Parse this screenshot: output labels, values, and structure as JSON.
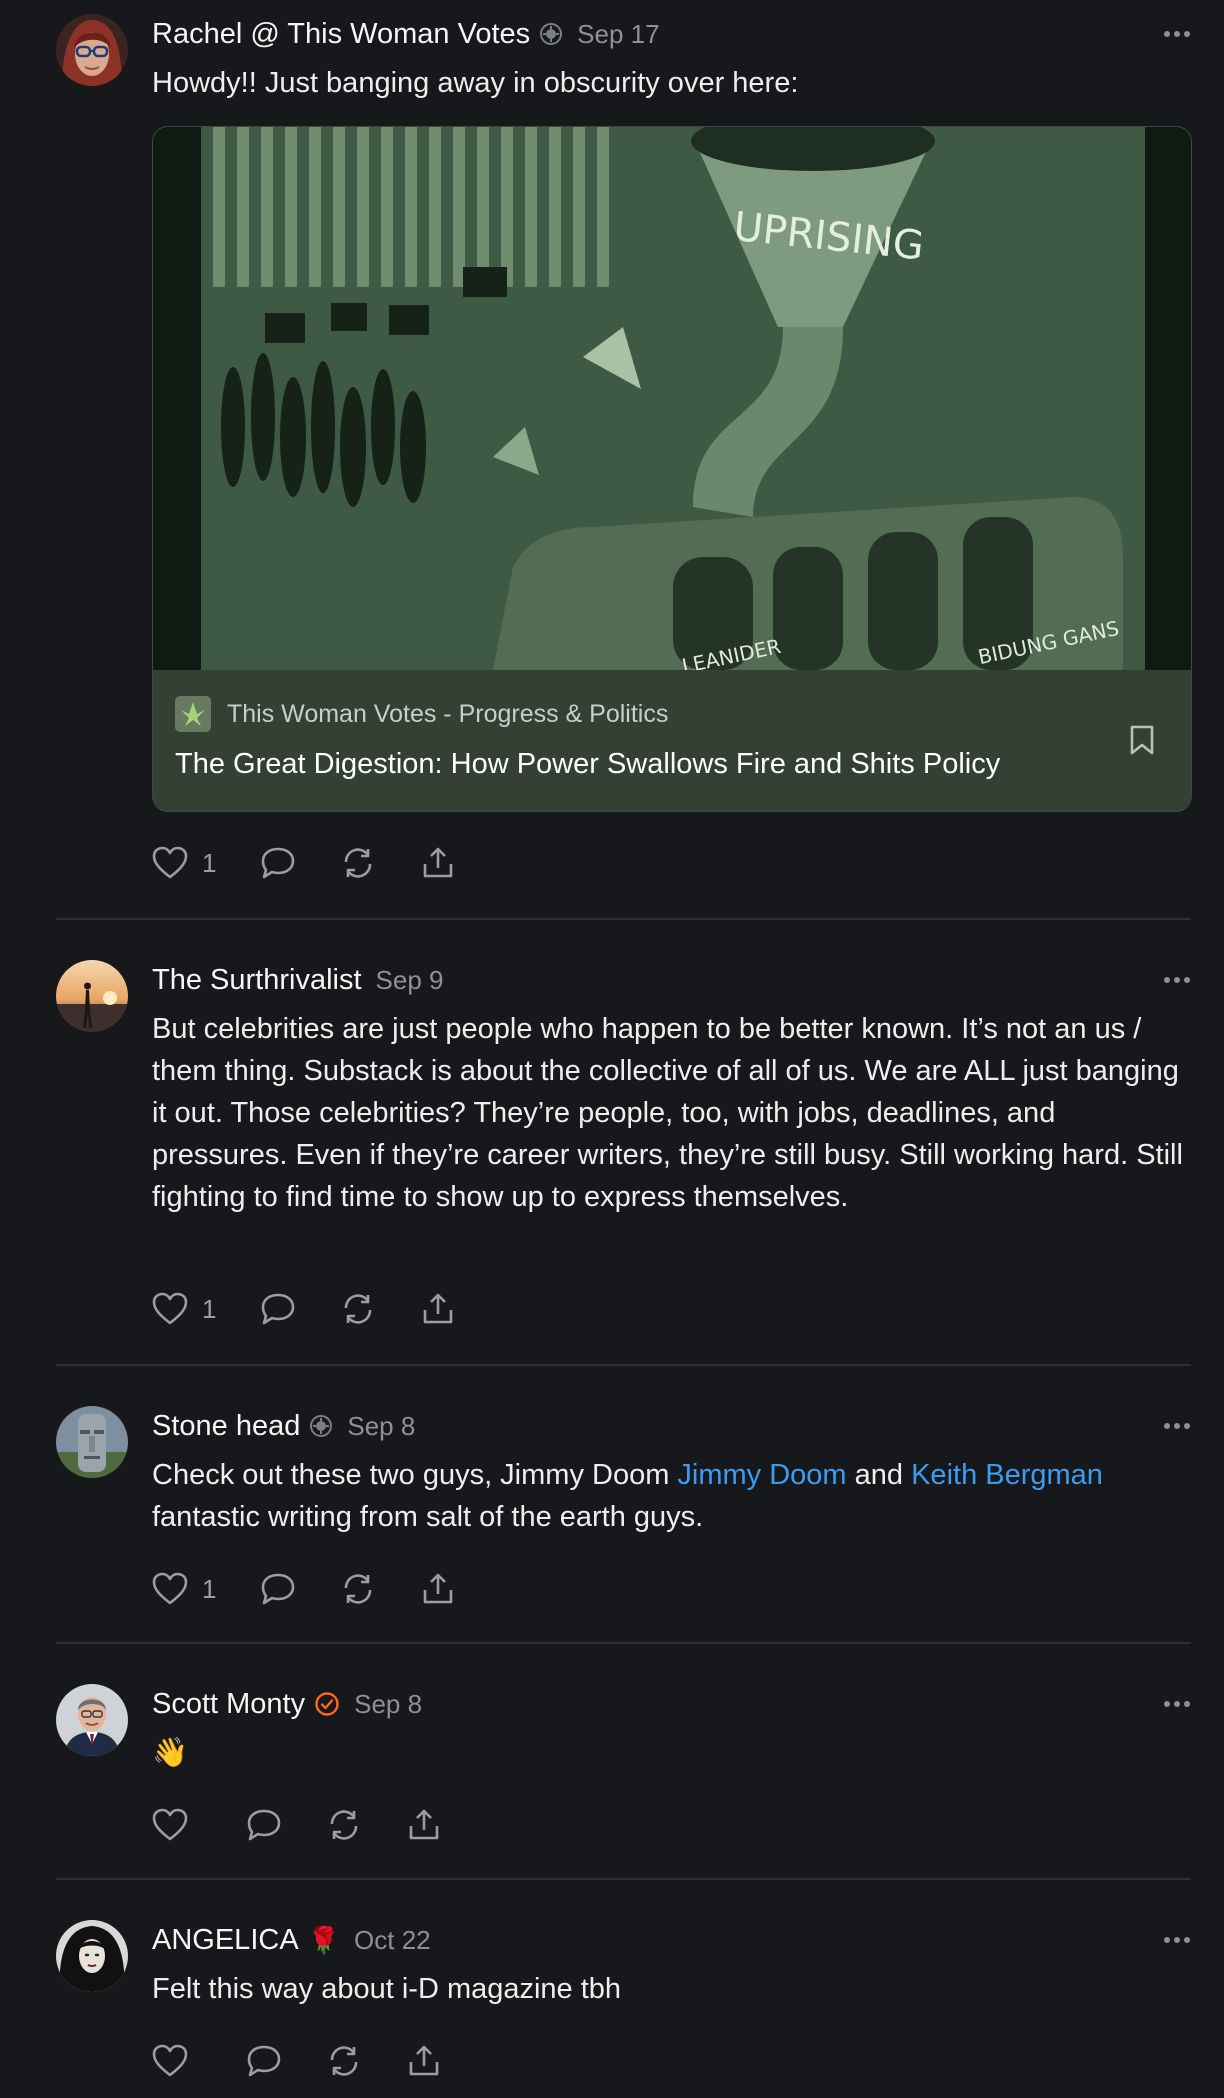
{
  "posts": [
    {
      "author": "Rachel @ This Woman Votes",
      "date": "Sep 17",
      "text": "Howdy!! Just banging away in obscurity over here:",
      "card": {
        "publication": "This Woman Votes - Progress & Politics",
        "title": "The Great Digestion: How Power Swallows Fire and Shits Policy",
        "image_text": {
          "funnel": "UPRISING",
          "slot_1": "LEANIDER",
          "slot_4": "BIDUNG GANS"
        }
      },
      "likes": "1"
    },
    {
      "author": "The Surthrivalist",
      "date": "Sep 9",
      "text": "But celebrities are just people who happen to be better known. It’s not an us / them thing. Substack is about the collective of all of us. We are ALL just banging it out. Those celebrities? They’re people, too, with jobs, deadlines, and pressures. Even if they’re career writers, they’re still busy. Still working hard. Still fighting to find time to show up to express themselves.",
      "likes": "1"
    },
    {
      "author": "Stone head",
      "date": "Sep 8",
      "text_before": "Check out these two guys, Jimmy Doom ",
      "mention_1": "Jimmy Doom",
      "text_middle": " and ",
      "mention_2": "Keith Bergman",
      "text_after": "fantastic writing from salt of the earth guys.",
      "likes": "1"
    },
    {
      "author": "Scott Monty",
      "date": "Sep 8",
      "text": "👋",
      "likes": ""
    },
    {
      "author": "ANGELICA",
      "author_emoji": "🌹",
      "date": "Oct 22",
      "text": "Felt this way about i-D magazine tbh",
      "likes": ""
    }
  ],
  "icons": {
    "like": "heart-icon",
    "reply": "comment-bubble-icon",
    "restack": "restack-arrows-icon",
    "share": "share-upload-icon",
    "more": "ellipsis-icon",
    "bookmark": "bookmark-icon",
    "verified": "verified-check-icon",
    "subscriber": "subscriber-badge-icon"
  },
  "colors": {
    "background": "#17181b",
    "mention": "#3b9cf2",
    "verified": "#ff6719",
    "muted": "#8d9096",
    "divider": "#2e3035"
  }
}
